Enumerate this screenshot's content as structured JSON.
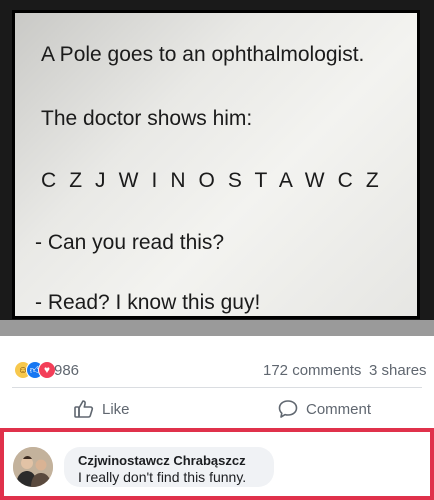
{
  "post_image": {
    "lines": [
      "A Pole goes to an ophthalmologist.",
      "The doctor shows him:",
      "C Z J W I N O S T A W C Z",
      "- Can you read this?",
      "- Read? I know this guy!"
    ]
  },
  "stats": {
    "reactions_count": "986",
    "reaction_icons": [
      "haha-icon",
      "like-icon",
      "love-icon"
    ],
    "comments": "172 comments",
    "shares": "3 shares"
  },
  "actions": {
    "like_label": "Like",
    "comment_label": "Comment"
  },
  "comment": {
    "author": "Czjwinostawcz Chrabąszcz",
    "text": "I really don't find this funny."
  },
  "colors": {
    "like_blue": "#1877f2",
    "love_red": "#f33e58",
    "haha_yellow": "#f7c84d",
    "highlight_border": "#e0314b",
    "secondary_text": "#606770"
  }
}
